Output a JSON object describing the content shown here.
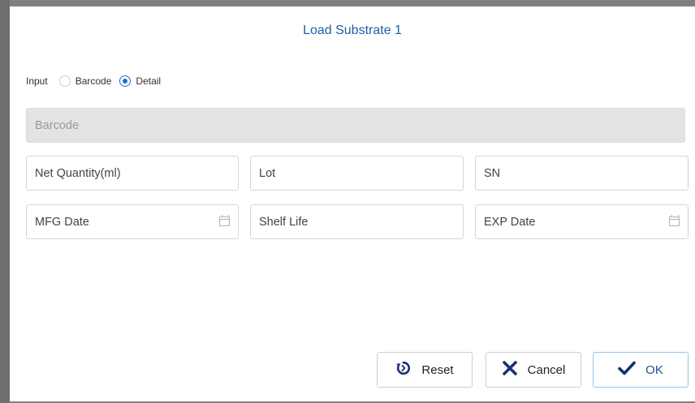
{
  "dialog": {
    "title": "Load Substrate 1"
  },
  "input_mode": {
    "label": "Input",
    "options": [
      {
        "label": "Barcode",
        "selected": false
      },
      {
        "label": "Detail",
        "selected": true
      }
    ]
  },
  "fields": {
    "barcode": {
      "placeholder": "Barcode",
      "disabled": true
    },
    "net_quantity": {
      "placeholder": "Net Quantity(ml)"
    },
    "lot": {
      "placeholder": "Lot"
    },
    "sn": {
      "placeholder": "SN"
    },
    "mfg_date": {
      "placeholder": "MFG Date",
      "icon": "calendar-icon"
    },
    "shelf_life": {
      "placeholder": "Shelf Life"
    },
    "exp_date": {
      "placeholder": "EXP Date",
      "icon": "calendar-icon"
    }
  },
  "buttons": {
    "reset": {
      "label": "Reset",
      "icon": "reset-icon"
    },
    "cancel": {
      "label": "Cancel",
      "icon": "close-icon"
    },
    "ok": {
      "label": "OK",
      "icon": "check-icon"
    }
  },
  "colors": {
    "title": "#1f5fa8",
    "accent": "#1f6fd0",
    "disabled_field": "#e3e3e3"
  }
}
